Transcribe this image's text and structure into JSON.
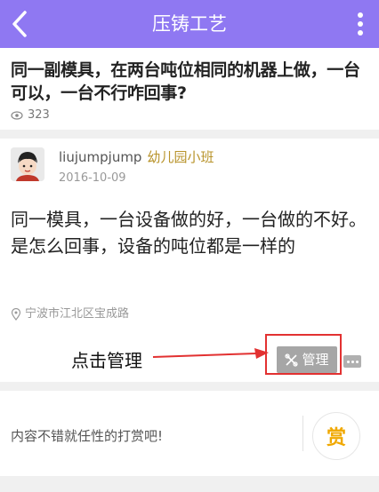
{
  "header": {
    "title": "压铸工艺",
    "back_icon": "chevron-left-icon",
    "more_icon": "more-vertical-icon",
    "background_color": "#8f78f2"
  },
  "question": {
    "title": "同一副模具，在两台吨位相同的机器上做，一台可以，一台不行咋回事?",
    "views": "323",
    "views_icon": "eye-icon"
  },
  "answer": {
    "username": "liujumpjump",
    "user_rank": "幼儿园小班",
    "date": "2016-10-09",
    "body": "同一模具，一台设备做的好，一台做的不好。是怎么回事，设备的吨位都是一样的",
    "location": "宁波市江北区宝成路",
    "location_icon": "location-pin-icon",
    "manage_label": "管理",
    "manage_icon": "tools-icon",
    "comment_icon": "comment-icon"
  },
  "annotation": {
    "text": "点击管理",
    "color": "#e23131"
  },
  "reward": {
    "text": "内容不错就任性的打赏吧!",
    "button_label": "赏",
    "accent_color": "#f0a800"
  }
}
